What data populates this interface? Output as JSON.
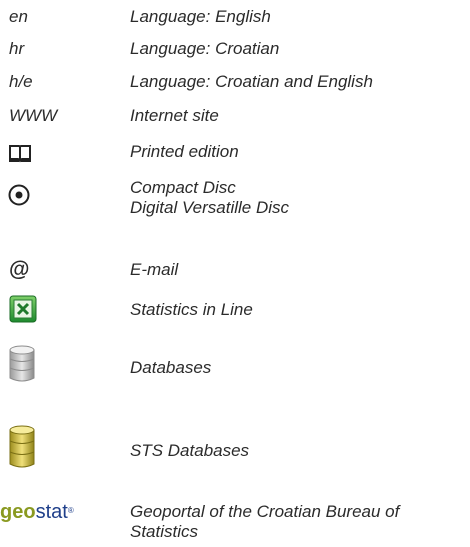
{
  "legend": [
    {
      "code": "en",
      "description": "Language: English"
    },
    {
      "code": "hr",
      "description": "Language: Croatian"
    },
    {
      "code": "h/e",
      "description": "Language: Croatian and English"
    },
    {
      "code": "WWW",
      "description": "Internet site"
    },
    {
      "icon": "book-icon",
      "description": "Printed edition"
    },
    {
      "icon": "disc-icon",
      "description_line1": "Compact Disc",
      "description_line2": "Digital Versatille Disc"
    },
    {
      "symbol": "@",
      "description": "E-mail"
    },
    {
      "icon": "spreadsheet-icon",
      "description": "Statistics in Line"
    },
    {
      "icon": "database-gray-icon",
      "description": "Databases"
    },
    {
      "icon": "database-gold-icon",
      "description": "STS Databases"
    },
    {
      "logo_part1": "geo",
      "logo_part2": "stat",
      "logo_mark": "®",
      "description_line1": "Geoportal of the Croatian Bureau of",
      "description_line2": "Statistics"
    }
  ]
}
